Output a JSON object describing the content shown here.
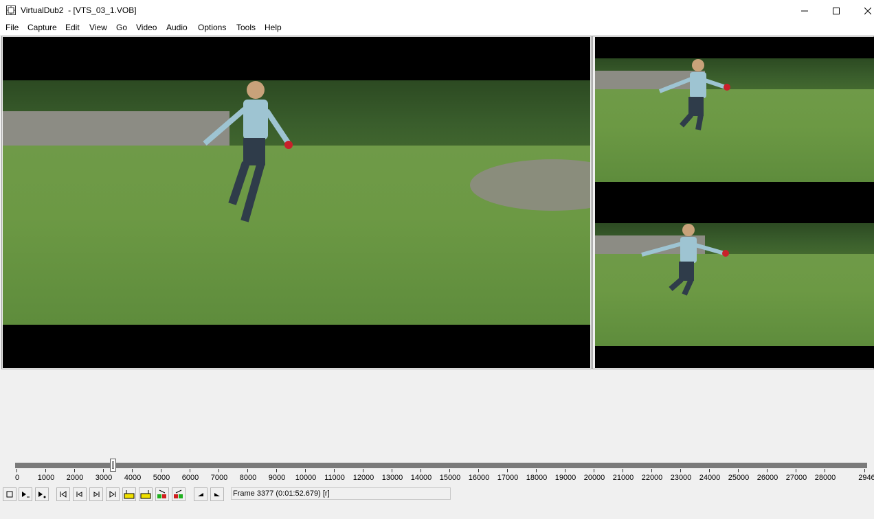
{
  "window": {
    "title": "VirtualDub2  - [VTS_03_1.VOB]"
  },
  "menu": [
    {
      "label": "File"
    },
    {
      "label": "Capture"
    },
    {
      "label": "Edit"
    },
    {
      "label": "View"
    },
    {
      "label": "Go"
    },
    {
      "label": "Video"
    },
    {
      "label": "Audio"
    },
    {
      "label": "Options"
    },
    {
      "label": "Tools"
    },
    {
      "label": "Help"
    }
  ],
  "timeline": {
    "ticks": [
      "0",
      "1000",
      "2000",
      "3000",
      "4000",
      "5000",
      "6000",
      "7000",
      "8000",
      "9000",
      "10000",
      "11000",
      "12000",
      "13000",
      "14000",
      "15000",
      "16000",
      "17000",
      "18000",
      "19000",
      "20000",
      "21000",
      "22000",
      "23000",
      "24000",
      "25000",
      "26000",
      "27000",
      "28000",
      "2946"
    ],
    "position_fraction": 0.1147
  },
  "toolbar": {
    "icons": [
      "stop-icon",
      "play-input-icon",
      "play-output-icon",
      "go-start-icon",
      "prev-frame-icon",
      "next-frame-icon",
      "go-end-icon",
      "prev-keyframe-icon",
      "next-keyframe-icon",
      "scene-back-icon",
      "scene-forward-icon",
      "mark-in-icon",
      "mark-out-icon"
    ]
  },
  "status": {
    "frame_text": "Frame 3377 (0:01:52.679) [r]"
  }
}
